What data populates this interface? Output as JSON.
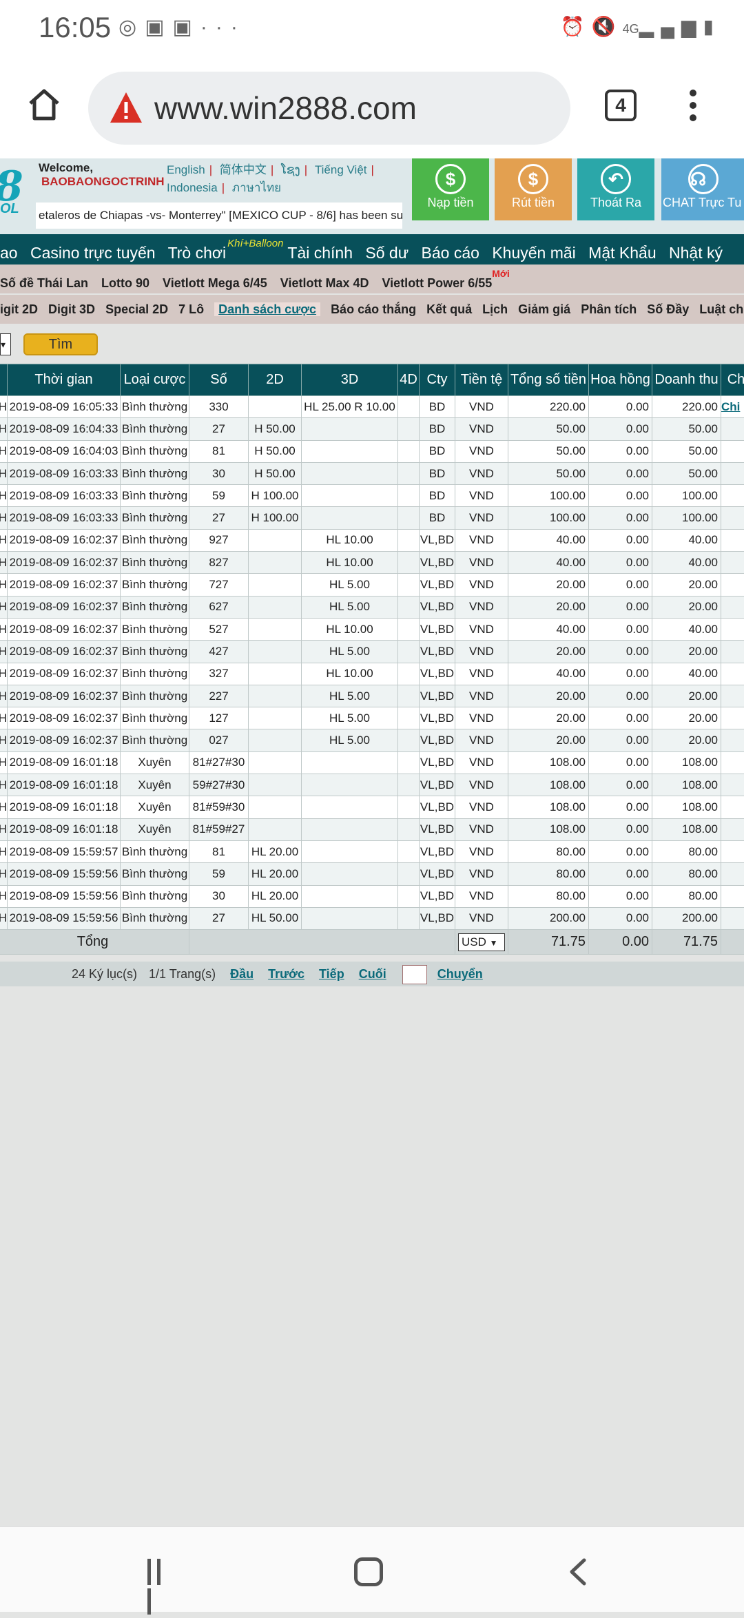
{
  "status_bar": {
    "time": "16:05",
    "network": "4G"
  },
  "browser": {
    "url": "www.win2888.com",
    "tab_count": "4"
  },
  "site_header": {
    "logo_char": "8",
    "logo_sub": "OL",
    "welcome": "Welcome,",
    "username": "BAOBAONGOCTRINH",
    "languages": [
      "English",
      "简体中文",
      "ໂຊງ",
      "Tiếng Việt",
      "Indonesia",
      "ภาษาไทย"
    ],
    "marquee": "etaleros de Chiapas -vs- Monterrey\" [MEXICO CUP - 8/6] has been su",
    "buttons": [
      {
        "label": "Nạp tiền",
        "color": "#4cb64a"
      },
      {
        "label": "Rút tiền",
        "color": "#e3a050"
      },
      {
        "label": "Thoát Ra",
        "color": "#2ba7a9"
      },
      {
        "label": "CHAT Trực Tu",
        "color": "#5ba8d4"
      }
    ]
  },
  "main_nav": {
    "items": [
      "ao",
      "Casino trực tuyến",
      "Trò chơi",
      "Tài chính",
      "Số dư",
      "Báo cáo",
      "Khuyến mãi",
      "Mật Khẩu",
      "Nhật ký"
    ],
    "game_badge": "Khí+Balloon"
  },
  "sub_nav_1": {
    "items": [
      "Số đề Thái Lan",
      "Lotto 90",
      "Vietlott Mega 6/45",
      "Vietlott Max 4D",
      "Vietlott Power 6/55"
    ],
    "new_badge": "Mới"
  },
  "sub_nav_2": {
    "items": [
      "igit 2D",
      "Digit 3D",
      "Special 2D",
      "7 Lô",
      "Danh sách cược",
      "Báo cáo thắng",
      "Kết quả",
      "Lịch",
      "Giảm giá",
      "Phân tích",
      "Số Đầy",
      "Luật chơi"
    ]
  },
  "search": {
    "button_label": "Tìm"
  },
  "table": {
    "headers": [
      "",
      "Thời gian",
      "Loại cược",
      "Số",
      "2D",
      "3D",
      "4D",
      "Cty",
      "Tiền tệ",
      "Tổng số tiền",
      "Hoa hồng",
      "Doanh thu",
      "Ch"
    ],
    "first_row_link": "Chi",
    "rows": [
      [
        "H",
        "2019-08-09 16:05:33",
        "Bình thường",
        "330",
        "",
        "HL 25.00 R 10.00",
        "",
        "BD",
        "VND",
        "220.00",
        "0.00",
        "220.00"
      ],
      [
        "H",
        "2019-08-09 16:04:33",
        "Bình thường",
        "27",
        "H 50.00",
        "",
        "",
        "BD",
        "VND",
        "50.00",
        "0.00",
        "50.00"
      ],
      [
        "H",
        "2019-08-09 16:04:03",
        "Bình thường",
        "81",
        "H 50.00",
        "",
        "",
        "BD",
        "VND",
        "50.00",
        "0.00",
        "50.00"
      ],
      [
        "H",
        "2019-08-09 16:03:33",
        "Bình thường",
        "30",
        "H 50.00",
        "",
        "",
        "BD",
        "VND",
        "50.00",
        "0.00",
        "50.00"
      ],
      [
        "H",
        "2019-08-09 16:03:33",
        "Bình thường",
        "59",
        "H 100.00",
        "",
        "",
        "BD",
        "VND",
        "100.00",
        "0.00",
        "100.00"
      ],
      [
        "H",
        "2019-08-09 16:03:33",
        "Bình thường",
        "27",
        "H 100.00",
        "",
        "",
        "BD",
        "VND",
        "100.00",
        "0.00",
        "100.00"
      ],
      [
        "H",
        "2019-08-09 16:02:37",
        "Bình thường",
        "927",
        "",
        "HL 10.00",
        "",
        "VL,BD",
        "VND",
        "40.00",
        "0.00",
        "40.00"
      ],
      [
        "H",
        "2019-08-09 16:02:37",
        "Bình thường",
        "827",
        "",
        "HL 10.00",
        "",
        "VL,BD",
        "VND",
        "40.00",
        "0.00",
        "40.00"
      ],
      [
        "H",
        "2019-08-09 16:02:37",
        "Bình thường",
        "727",
        "",
        "HL 5.00",
        "",
        "VL,BD",
        "VND",
        "20.00",
        "0.00",
        "20.00"
      ],
      [
        "H",
        "2019-08-09 16:02:37",
        "Bình thường",
        "627",
        "",
        "HL 5.00",
        "",
        "VL,BD",
        "VND",
        "20.00",
        "0.00",
        "20.00"
      ],
      [
        "H",
        "2019-08-09 16:02:37",
        "Bình thường",
        "527",
        "",
        "HL 10.00",
        "",
        "VL,BD",
        "VND",
        "40.00",
        "0.00",
        "40.00"
      ],
      [
        "H",
        "2019-08-09 16:02:37",
        "Bình thường",
        "427",
        "",
        "HL 5.00",
        "",
        "VL,BD",
        "VND",
        "20.00",
        "0.00",
        "20.00"
      ],
      [
        "H",
        "2019-08-09 16:02:37",
        "Bình thường",
        "327",
        "",
        "HL 10.00",
        "",
        "VL,BD",
        "VND",
        "40.00",
        "0.00",
        "40.00"
      ],
      [
        "H",
        "2019-08-09 16:02:37",
        "Bình thường",
        "227",
        "",
        "HL 5.00",
        "",
        "VL,BD",
        "VND",
        "20.00",
        "0.00",
        "20.00"
      ],
      [
        "H",
        "2019-08-09 16:02:37",
        "Bình thường",
        "127",
        "",
        "HL 5.00",
        "",
        "VL,BD",
        "VND",
        "20.00",
        "0.00",
        "20.00"
      ],
      [
        "H",
        "2019-08-09 16:02:37",
        "Bình thường",
        "027",
        "",
        "HL 5.00",
        "",
        "VL,BD",
        "VND",
        "20.00",
        "0.00",
        "20.00"
      ],
      [
        "H",
        "2019-08-09 16:01:18",
        "Xuyên",
        "81#27#30",
        "",
        "",
        "",
        "VL,BD",
        "VND",
        "108.00",
        "0.00",
        "108.00"
      ],
      [
        "H",
        "2019-08-09 16:01:18",
        "Xuyên",
        "59#27#30",
        "",
        "",
        "",
        "VL,BD",
        "VND",
        "108.00",
        "0.00",
        "108.00"
      ],
      [
        "H",
        "2019-08-09 16:01:18",
        "Xuyên",
        "81#59#30",
        "",
        "",
        "",
        "VL,BD",
        "VND",
        "108.00",
        "0.00",
        "108.00"
      ],
      [
        "H",
        "2019-08-09 16:01:18",
        "Xuyên",
        "81#59#27",
        "",
        "",
        "",
        "VL,BD",
        "VND",
        "108.00",
        "0.00",
        "108.00"
      ],
      [
        "H",
        "2019-08-09 15:59:57",
        "Bình thường",
        "81",
        "HL 20.00",
        "",
        "",
        "VL,BD",
        "VND",
        "80.00",
        "0.00",
        "80.00"
      ],
      [
        "H",
        "2019-08-09 15:59:56",
        "Bình thường",
        "59",
        "HL 20.00",
        "",
        "",
        "VL,BD",
        "VND",
        "80.00",
        "0.00",
        "80.00"
      ],
      [
        "H",
        "2019-08-09 15:59:56",
        "Bình thường",
        "30",
        "HL 20.00",
        "",
        "",
        "VL,BD",
        "VND",
        "80.00",
        "0.00",
        "80.00"
      ],
      [
        "H",
        "2019-08-09 15:59:56",
        "Bình thường",
        "27",
        "HL 50.00",
        "",
        "",
        "VL,BD",
        "VND",
        "200.00",
        "0.00",
        "200.00"
      ]
    ],
    "total": {
      "label": "Tổng",
      "currency": "USD",
      "amount": "71.75",
      "commission": "0.00",
      "turnover": "71.75"
    }
  },
  "pager": {
    "records": "24 Ký lục(s)",
    "pages": "1/1 Trang(s)",
    "first": "Đầu",
    "prev": "Trước",
    "next": "Tiếp",
    "last": "Cuối",
    "go": "Chuyển"
  }
}
